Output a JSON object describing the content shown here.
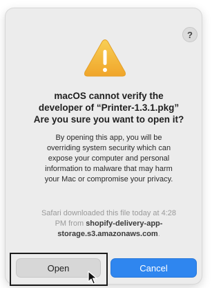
{
  "dialog": {
    "help_label": "?",
    "icon": "warning-triangle-icon",
    "title_lines": [
      "macOS cannot verify the",
      "developer of “Printer-1.3.1.pkg”",
      "Are you sure you want to open it?"
    ],
    "body_lines": [
      "By opening this app, you will be",
      "overriding system security which can",
      "expose your computer and personal",
      "information to malware that may harm",
      "your Mac or compromise your privacy."
    ],
    "source": {
      "prefix_line1": "Safari downloaded this file today at 4:28",
      "prefix_line2": "PM from ",
      "host_part1": "shopify-delivery-app-",
      "host_part2": "storage.s3.amazonaws.com",
      "suffix": "."
    },
    "buttons": {
      "open_label": "Open",
      "cancel_label": "Cancel"
    }
  },
  "colors": {
    "dialog_bg": "#ececec",
    "accent_blue": "#2f86ef",
    "warning_yellow": "#f4b63a"
  }
}
